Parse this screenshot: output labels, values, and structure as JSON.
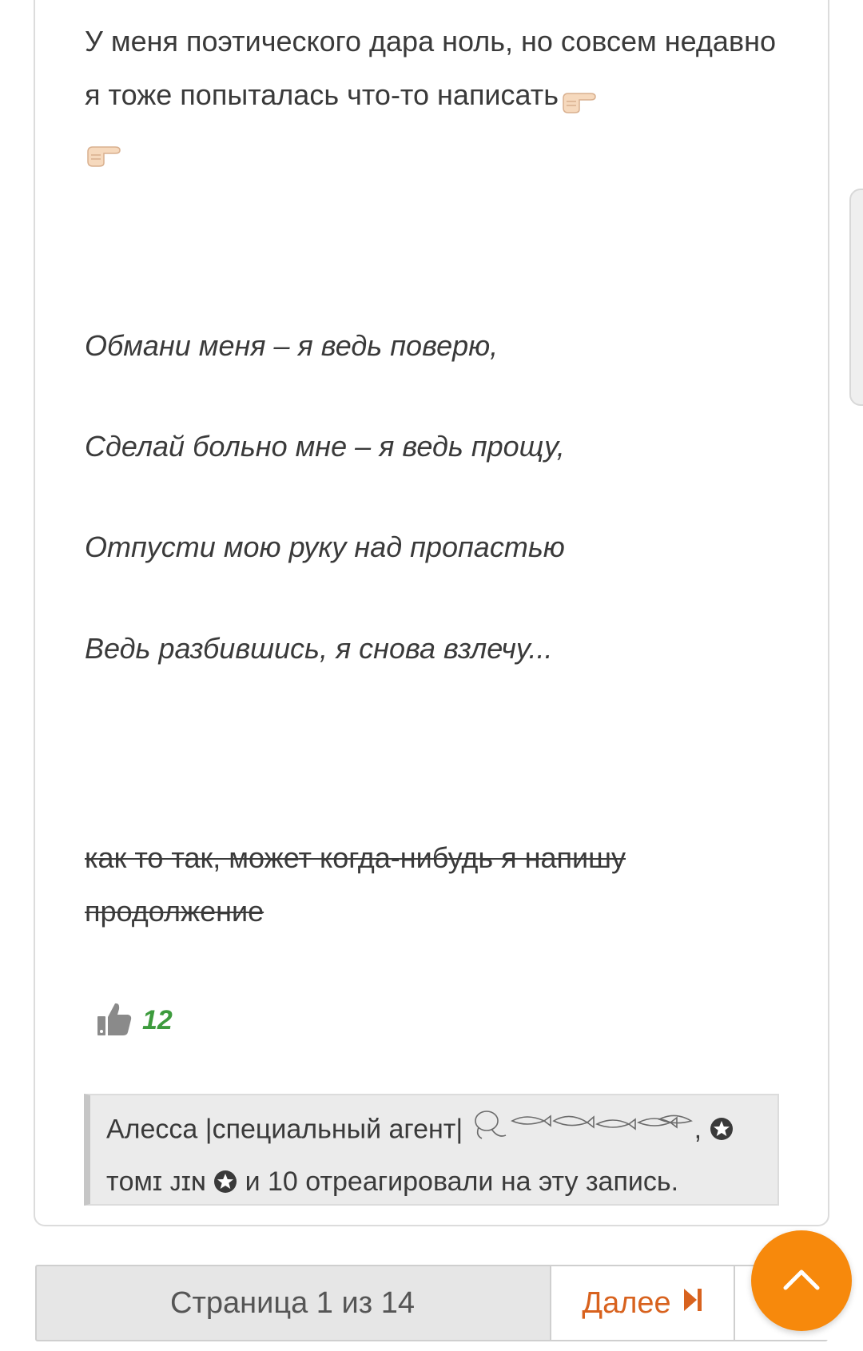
{
  "post": {
    "intro_text": "У меня поэтического дара ноль, но совсем недавно я тоже попыталась что-то написать",
    "intro_emoji": [
      "pointing-right-icon",
      "pointing-right-icon"
    ],
    "poem": [
      "Обмани меня – я ведь поверю,",
      "Сделай больно мне – я ведь прощу,",
      "Отпусти мою руку над пропастью",
      "Ведь разбившись, я снова взлечу..."
    ],
    "struck_text": "как то так, может когда-нибудь я напишу продолжение",
    "likes": {
      "count": "12",
      "icon": "thumbs-up-icon"
    },
    "reactions": {
      "user_one": "Алесса |специальный агент|",
      "separator": ",",
      "user_two": "тᴏᴍɪ ᴊɪɴ",
      "tail": "и 10 отреагировали на эту запись.",
      "icons": [
        "fish-doodle-icon",
        "star-circle-icon"
      ]
    }
  },
  "pagination": {
    "label": "Страница 1 из 14",
    "next_label": "Далее",
    "next_icon": "skip-next-icon"
  },
  "scroll_top": {
    "icon": "chevron-up-icon"
  },
  "colors": {
    "accent": "#f7890c",
    "next_text": "#d8621e",
    "likes": "#3d9b3d"
  }
}
